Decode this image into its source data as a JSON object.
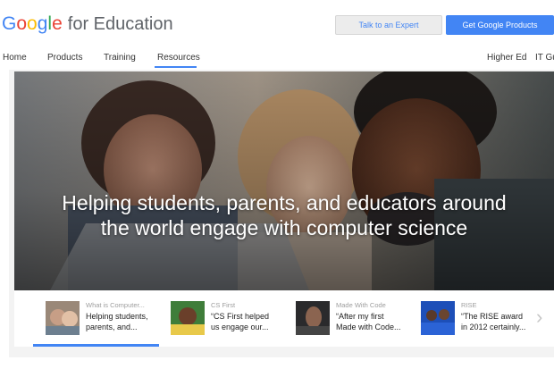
{
  "header": {
    "logo_google": "Google",
    "logo_suffix": "for Education",
    "talk_button": "Talk to an Expert",
    "products_button": "Get Google Products"
  },
  "nav": {
    "items": [
      "Home",
      "Products",
      "Training",
      "Resources"
    ],
    "right_items": [
      "Higher Ed",
      "IT Gu"
    ],
    "active": "Resources"
  },
  "hero": {
    "title_line1": "Helping students, parents, and educators around",
    "title_line2": "the world engage with computer science"
  },
  "carousel": {
    "cards": [
      {
        "category": "What is Computer...",
        "title_line1": "Helping students,",
        "title_line2": "parents, and..."
      },
      {
        "category": "CS First",
        "title_line1": "“CS First helped",
        "title_line2": "us engage our..."
      },
      {
        "category": "Made With Code",
        "title_line1": "“After my first",
        "title_line2": "Made with Code..."
      },
      {
        "category": "RISE",
        "title_line1": "“The RISE award",
        "title_line2": "in 2012 certainly..."
      }
    ],
    "next_icon": "chevron-right-icon"
  },
  "colors": {
    "accent": "#4285f4"
  }
}
